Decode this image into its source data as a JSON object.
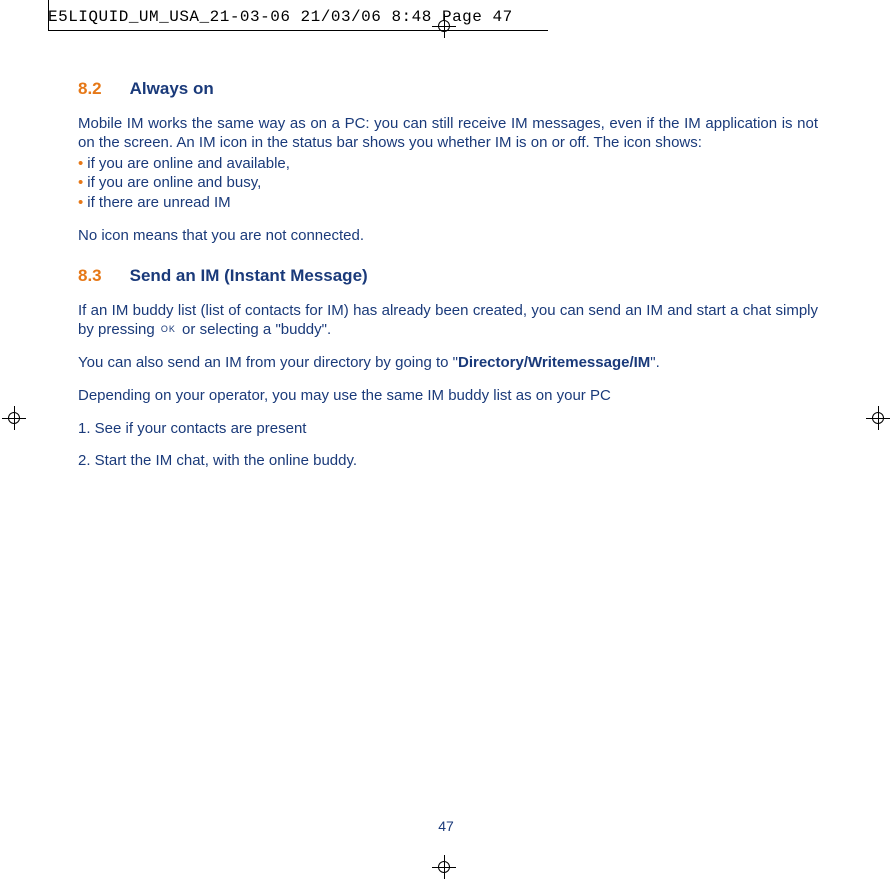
{
  "crop_header": "E5LIQUID_UM_USA_21-03-06  21/03/06  8:48  Page 47",
  "s82": {
    "num": "8.2",
    "title": "Always on",
    "intro": "Mobile IM works the same way as on a PC: you can still receive IM messages, even if the IM application is not on the screen. An IM icon in the status bar shows you whether IM is on or off. The icon shows:",
    "bullets": [
      "if you are online and available,",
      "if you are online and busy,",
      "if there are unread IM"
    ],
    "closing": "No icon means that you are not connected."
  },
  "s83": {
    "num": "8.3",
    "title": "Send an IM (Instant Message)",
    "p1a": "If an IM buddy list (list of contacts for IM) has already been created, you can send an IM and start a chat simply by pressing ",
    "ok": "OK",
    "p1b": " or selecting a \"buddy\".",
    "p2a": "You can also send an IM from your directory by going to \"",
    "p2b": "Directory/Writemessage/IM",
    "p2c": "\".",
    "p3": "Depending on your operator, you may use the same IM buddy list as on your PC",
    "step1": "1. See if your contacts are present",
    "step2": "2. Start the IM chat, with the online buddy."
  },
  "page_number": "47"
}
